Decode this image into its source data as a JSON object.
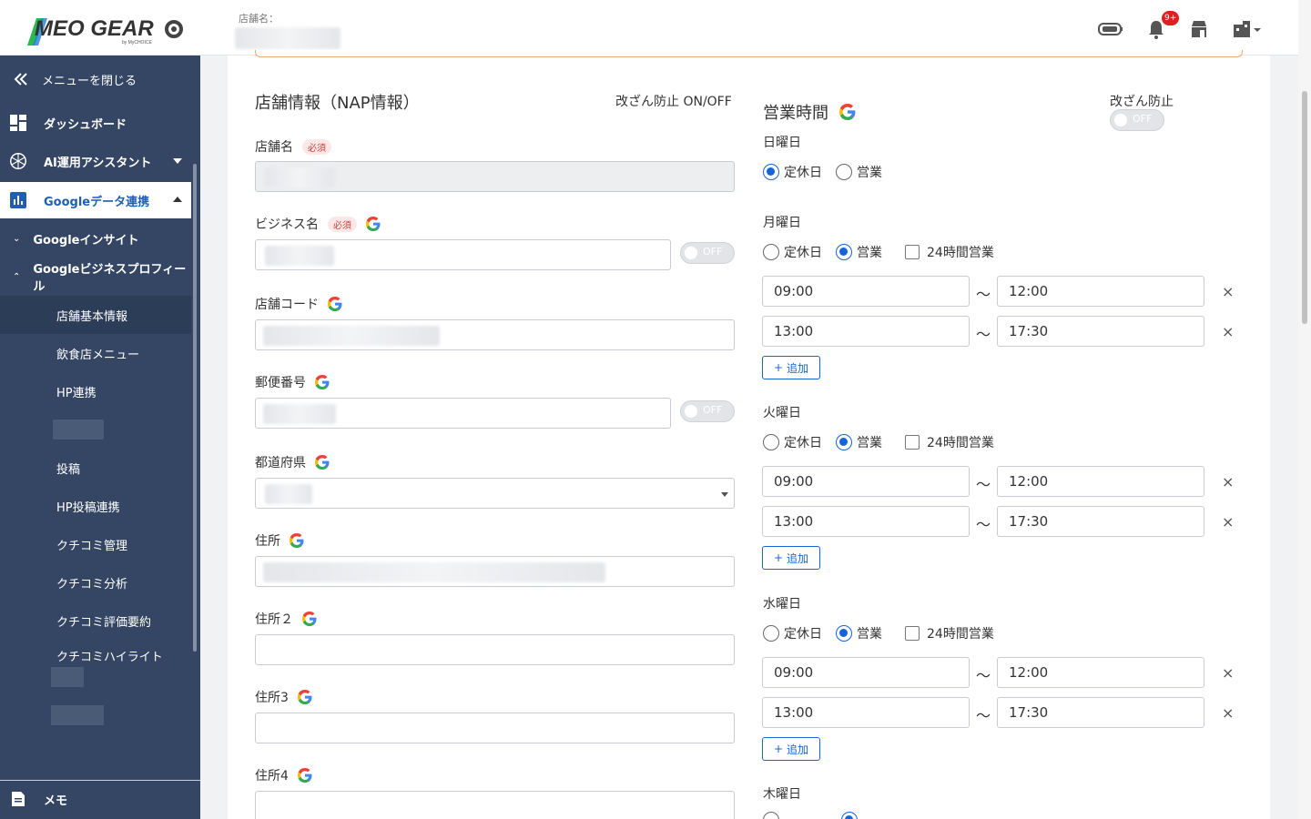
{
  "header": {
    "logo_text": "MEO GEAR",
    "logo_sub": "by MyCHOICE",
    "store_label": "店舗名：",
    "notification_count": "9+"
  },
  "sidebar": {
    "close_menu": "メニューを閉じる",
    "dashboard": "ダッシュボード",
    "ai_assistant": "AI運用アシスタント",
    "google_link": "Googleデータ連携",
    "google_insight": "Googleインサイト",
    "google_profile": "Googleビジネスプロフィール",
    "sub_items": [
      "店舗基本情報",
      "飲食店メニュー",
      "HP連携",
      "",
      "投稿",
      "HP投稿連携",
      "クチコミ管理",
      "クチコミ分析",
      "クチコミ評価要約",
      "クチコミハイライト"
    ],
    "memo": "メモ"
  },
  "nap": {
    "title": "店舗情報（NAP情報）",
    "tamper_toggle_label": "改ざん防止 ON/OFF",
    "required": "必須",
    "toggle_off": "OFF",
    "fields": {
      "store_name": "店舗名",
      "business_name": "ビジネス名",
      "store_code": "店舗コード",
      "postal_code": "郵便番号",
      "prefecture": "都道府県",
      "address1": "住所",
      "address2": "住所２",
      "address3": "住所3",
      "address4": "住所4"
    }
  },
  "hours": {
    "title": "営業時間",
    "tamper_label": "改ざん防止",
    "toggle_off": "OFF",
    "closed": "定休日",
    "open": "営業",
    "all_day": "24時間営業",
    "add": "追加",
    "tilde": "〜",
    "days": {
      "sun": "日曜日",
      "mon": "月曜日",
      "tue": "火曜日",
      "wed": "水曜日",
      "thu": "木曜日"
    },
    "slots": {
      "s1_start": "09:00",
      "s1_end": "12:00",
      "s2_start": "13:00",
      "s2_end": "17:30"
    }
  }
}
